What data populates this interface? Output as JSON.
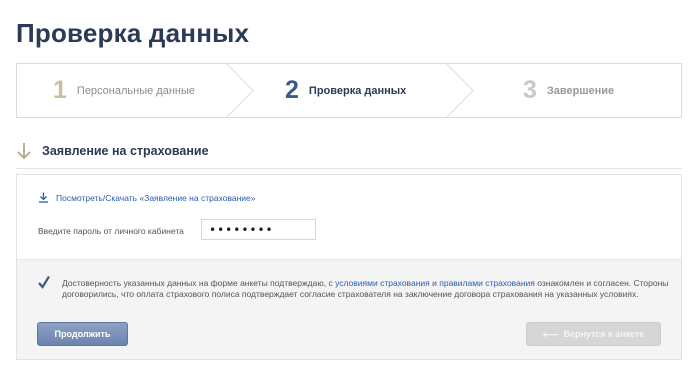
{
  "page": {
    "title": "Проверка данных"
  },
  "steps": [
    {
      "number": "1",
      "label": "Персональные данные",
      "state": "done"
    },
    {
      "number": "2",
      "label": "Проверка данных",
      "state": "active"
    },
    {
      "number": "3",
      "label": "Завершение",
      "state": "pending"
    }
  ],
  "section": {
    "title": "Заявление на страхование",
    "icon": "arrow-down-icon"
  },
  "download": {
    "label": "Посмотреть/Скачать «Заявление на страхование»",
    "icon": "download-icon"
  },
  "password": {
    "label": "Введите пароль от личного кабинета",
    "value": "••••••••"
  },
  "agreement": {
    "checked": true,
    "text_1": "Достоверность указанных данных на форме анкеты подтверждаю, с ",
    "link_terms": "условиями страхования",
    "text_2": " и ",
    "link_rules": "правилами страхования",
    "text_3": " ознакомлен и согласен. Стороны договорились, что оплата страхового полиса подтверждает согласие страхователя на заключение договора страхования на указанных условиях."
  },
  "buttons": {
    "continue": "Продолжить",
    "back": "Вернутся к анкете",
    "back_icon": "arrow-left-icon"
  },
  "colors": {
    "title": "#2b3a55",
    "link": "#2a5db0",
    "primary_button": "#7a8fb6",
    "disabled_button": "#d6d6d6"
  }
}
